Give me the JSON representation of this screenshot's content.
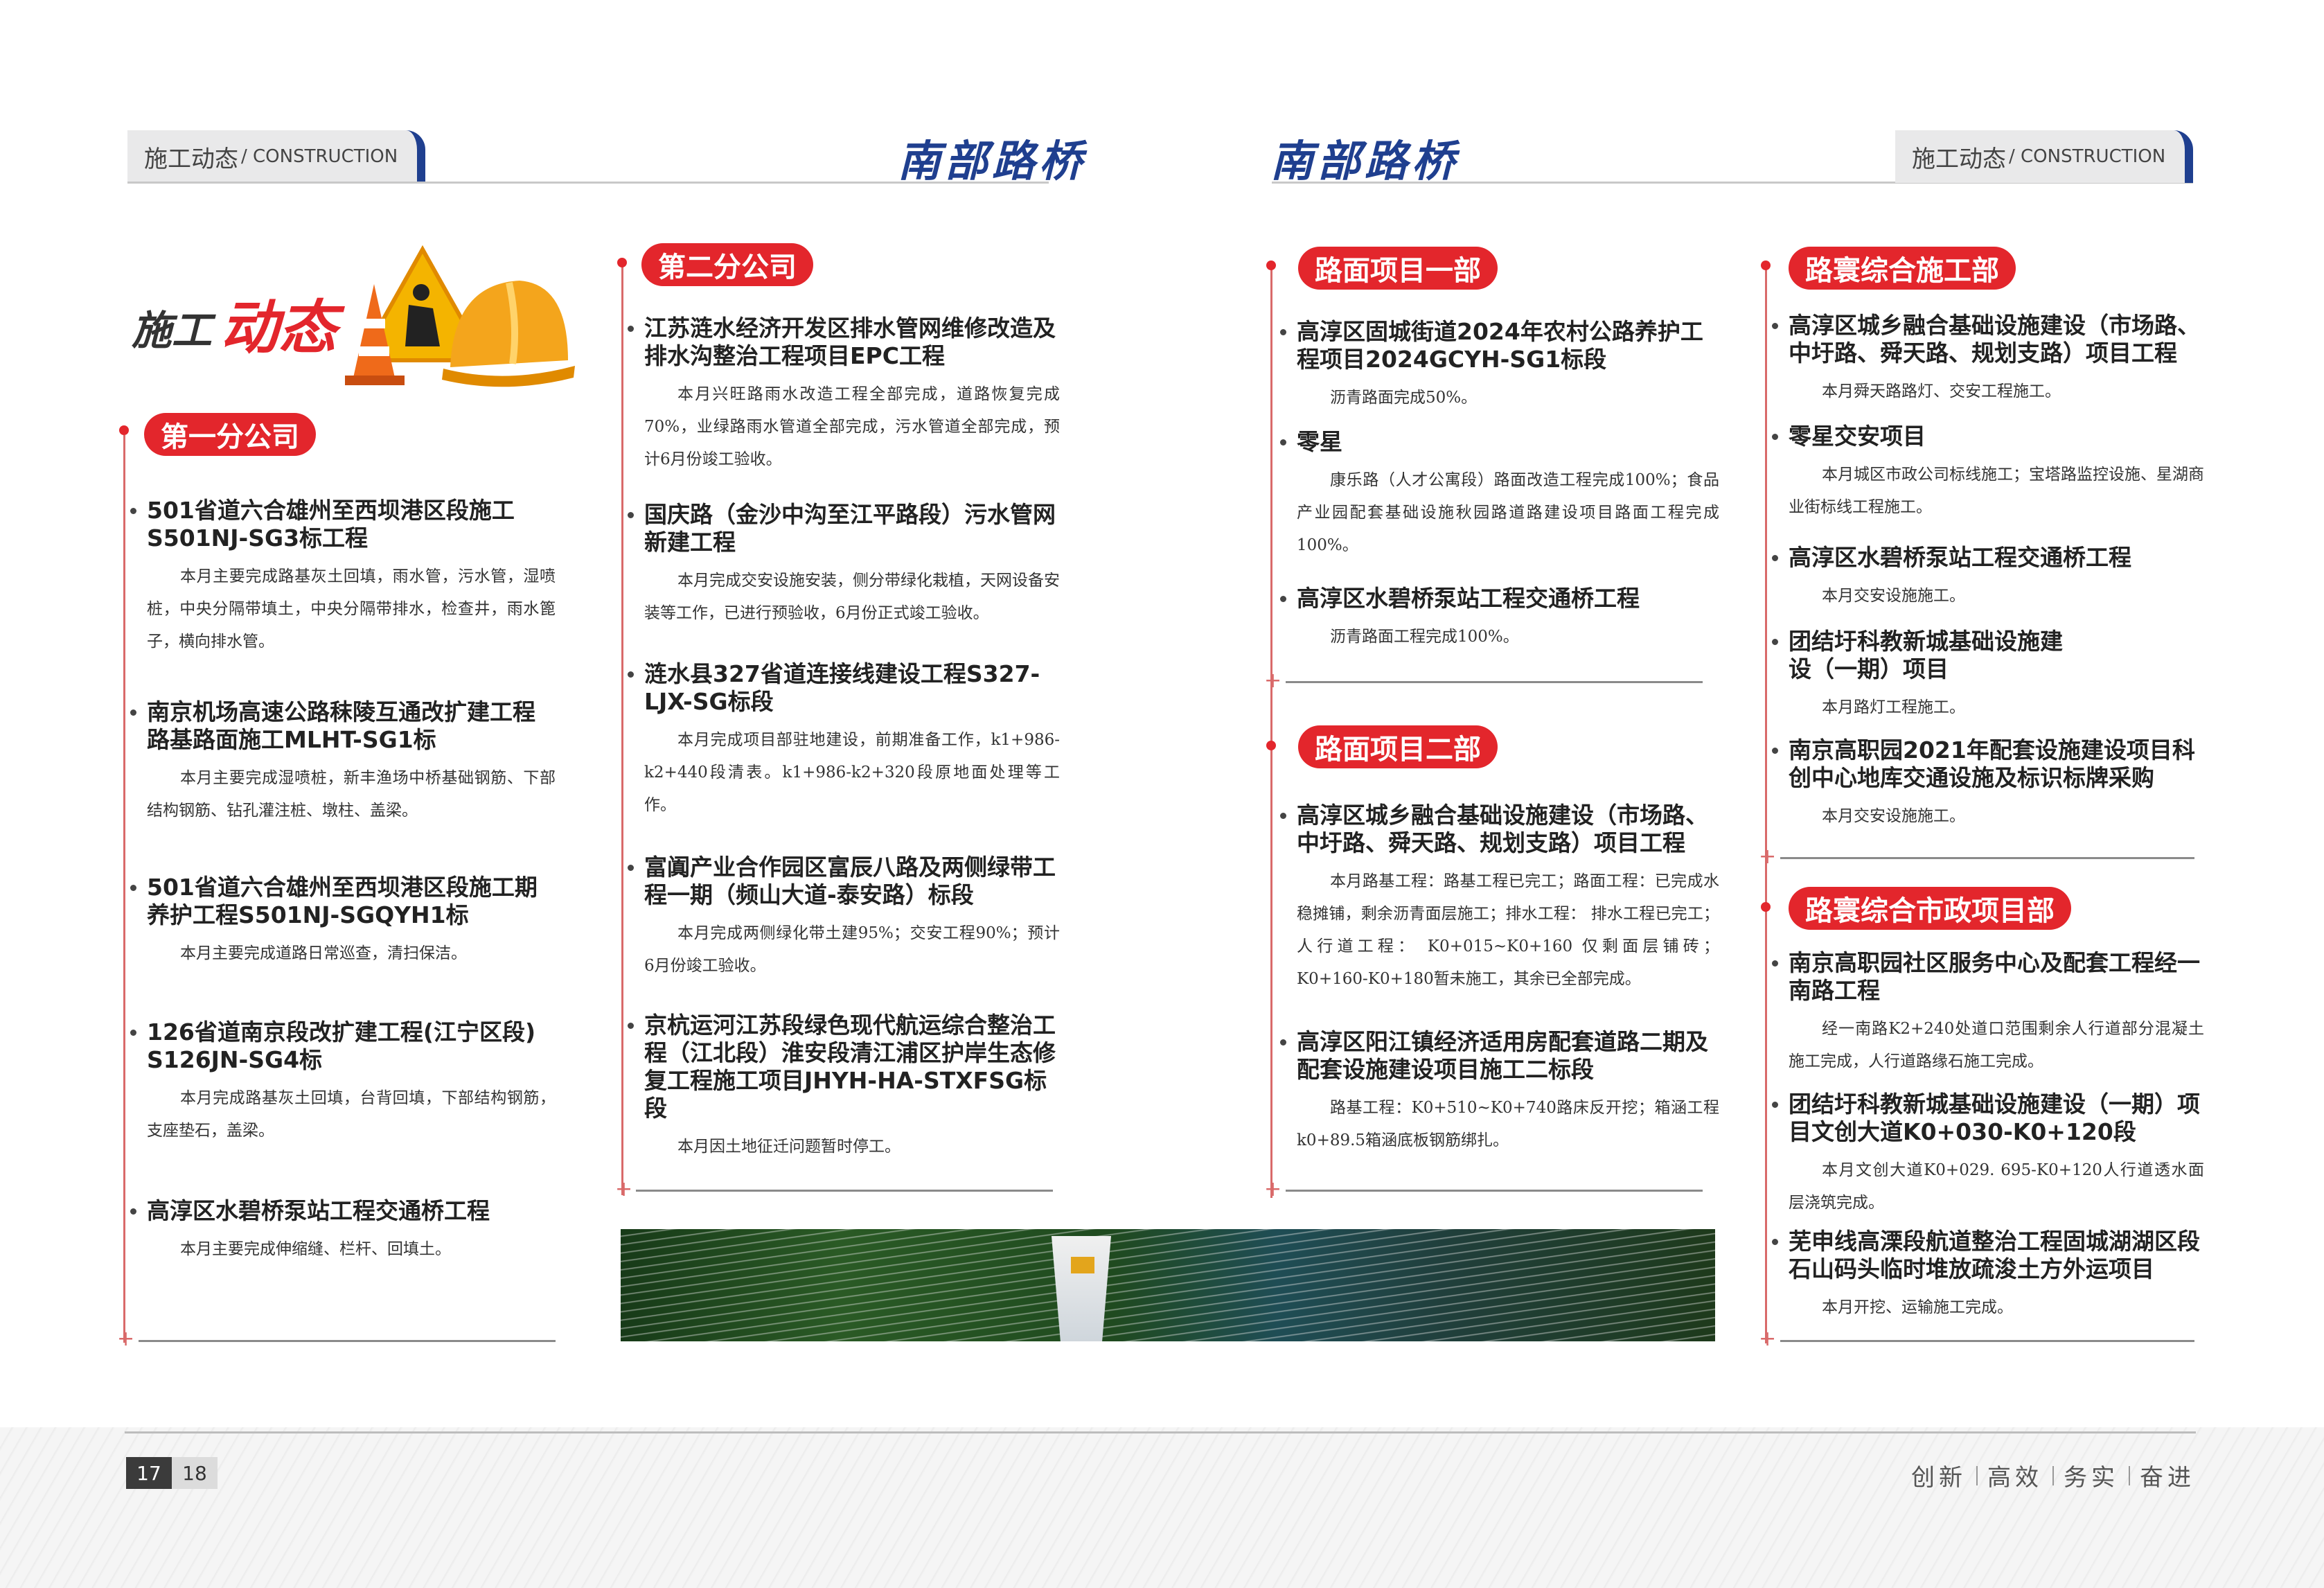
{
  "header": {
    "left_tab_cn": "施工动态",
    "left_tab_en": "/ CONSTRUCTION",
    "right_tab_cn": "施工动态",
    "right_tab_en": "/ CONSTRUCTION",
    "brand": "南部路桥"
  },
  "logo": {
    "text1": "施工",
    "text2": "动态"
  },
  "col1": {
    "section": "第一分公司",
    "items": [
      {
        "title": "501省道六合雄州至西坝港区段施工S501NJ-SG3标工程",
        "body": "本月主要完成路基灰土回填，雨水管，污水管，湿喷桩，中央分隔带填土，中央分隔带排水，检查井，雨水篦子，横向排水管。"
      },
      {
        "title": "南京机场高速公路秣陵互通改扩建工程路基路面施工MLHT-SG1标",
        "body": "本月主要完成湿喷桩，新丰渔场中桥基础钢筋、下部结构钢筋、钻孔灌注桩、墩柱、盖梁。"
      },
      {
        "title": "501省道六合雄州至西坝港区段施工期养护工程S501NJ-SGQYH1标",
        "body": "本月主要完成道路日常巡查，清扫保洁。"
      },
      {
        "title": "126省道南京段改扩建工程(江宁区段) S126JN-SG4标",
        "body": "本月完成路基灰土回填，台背回填，下部结构钢筋，支座垫石，盖梁。"
      },
      {
        "title": "高淳区水碧桥泵站工程交通桥工程",
        "body": "本月主要完成伸缩缝、栏杆、回填土。"
      }
    ]
  },
  "col2": {
    "section": "第二分公司",
    "items": [
      {
        "title": "江苏涟水经济开发区排水管网维修改造及排水沟整治工程项目EPC工程",
        "body": "本月兴旺路雨水改造工程全部完成，道路恢复完成70%，业绿路雨水管道全部完成，污水管道全部完成，预计6月份竣工验收。"
      },
      {
        "title": "国庆路（金沙中沟至江平路段）污水管网新建工程",
        "body": "本月完成交安设施安装，侧分带绿化栽植，天网设备安装等工作，已进行预验收，6月份正式竣工验收。"
      },
      {
        "title": "涟水县327省道连接线建设工程S327-LJX-SG标段",
        "body": "本月完成项目部驻地建设，前期准备工作，k1+986-k2+440段清表。k1+986-k2+320段原地面处理等工作。"
      },
      {
        "title": "富阗产业合作园区富辰八路及两侧绿带工程一期（频山大道-泰安路）标段",
        "body": "本月完成两侧绿化带土建95%；交安工程90%；预计6月份竣工验收。"
      },
      {
        "title": "京杭运河江苏段绿色现代航运综合整治工程（江北段）淮安段清江浦区护岸生态修复工程施工项目JHYH-HA-STXFSG标段",
        "body": "本月因土地征迁问题暂时停工。"
      }
    ]
  },
  "col3": {
    "section1": "路面项目一部",
    "items1": [
      {
        "title": "高淳区固城街道2024年农村公路养护工程项目2024GCYH-SG1标段",
        "body": "沥青路面完成50%。"
      },
      {
        "title": "零星",
        "body": "康乐路（人才公寓段）路面改造工程完成100%；食品产业园配套基础设施秋园路道路建设项目路面工程完成100%。"
      },
      {
        "title": "高淳区水碧桥泵站工程交通桥工程",
        "body": "沥青路面工程完成100%。"
      }
    ],
    "section2": "路面项目二部",
    "items2": [
      {
        "title": "高淳区城乡融合基础设施建设（市场路、中圩路、舜天路、规划支路）项目工程",
        "body": "本月路基工程：路基工程已完工；路面工程：已完成水稳摊铺，剩余沥青面层施工；排水工程： 排水工程已完工；人行道工程： K0+015~K0+160 仅剩面层铺砖；K0+160-K0+180暂未施工，其余已全部完成。"
      },
      {
        "title": "高淳区阳江镇经济适用房配套道路二期及配套设施建设项目施工二标段",
        "body": "路基工程：K0+510~K0+740路床反开挖；箱涵工程k0+89.5箱涵底板钢筋绑扎。"
      }
    ]
  },
  "col4": {
    "section1": "路寰综合施工部",
    "items1": [
      {
        "title": "高淳区城乡融合基础设施建设（市场路、中圩路、舜天路、规划支路）项目工程",
        "body": "本月舜天路路灯、交安工程施工。"
      },
      {
        "title": "零星交安项目",
        "body": "本月城区市政公司标线施工；宝塔路监控设施、星湖商业街标线工程施工。"
      },
      {
        "title": "高淳区水碧桥泵站工程交通桥工程",
        "body": "本月交安设施施工。"
      },
      {
        "title": "团结圩科教新城基础设施建设（一期）项目",
        "body": "本月路灯工程施工。"
      },
      {
        "title": "南京高职园2021年配套设施建设项目科创中心地库交通设施及标识标牌采购",
        "body": "本月交安设施施工。"
      }
    ],
    "section2": "路寰综合市政项目部",
    "items2": [
      {
        "title": "南京高职园社区服务中心及配套工程经一南路工程",
        "body": "经一南路K2+240处道口范围剩余人行道部分混凝土施工完成，人行道路缘石施工完成。"
      },
      {
        "title": "团结圩科教新城基础设施建设（一期）项目文创大道K0+030-K0+120段",
        "body": "本月文创大道K0+029. 695-K0+120人行道透水面层浇筑完成。"
      },
      {
        "title": "芜申线高溧段航道整治工程固城湖湖区段石山码头临时堆放疏浚土方外运项目",
        "body": "本月开挖、运输施工完成。"
      }
    ]
  },
  "footer": {
    "page_left": "17",
    "page_right": "18",
    "slogan": [
      "创新",
      "高效",
      "务实",
      "奋进"
    ]
  },
  "colors": {
    "red": "#e3262c",
    "blue": "#1f3f8f"
  }
}
